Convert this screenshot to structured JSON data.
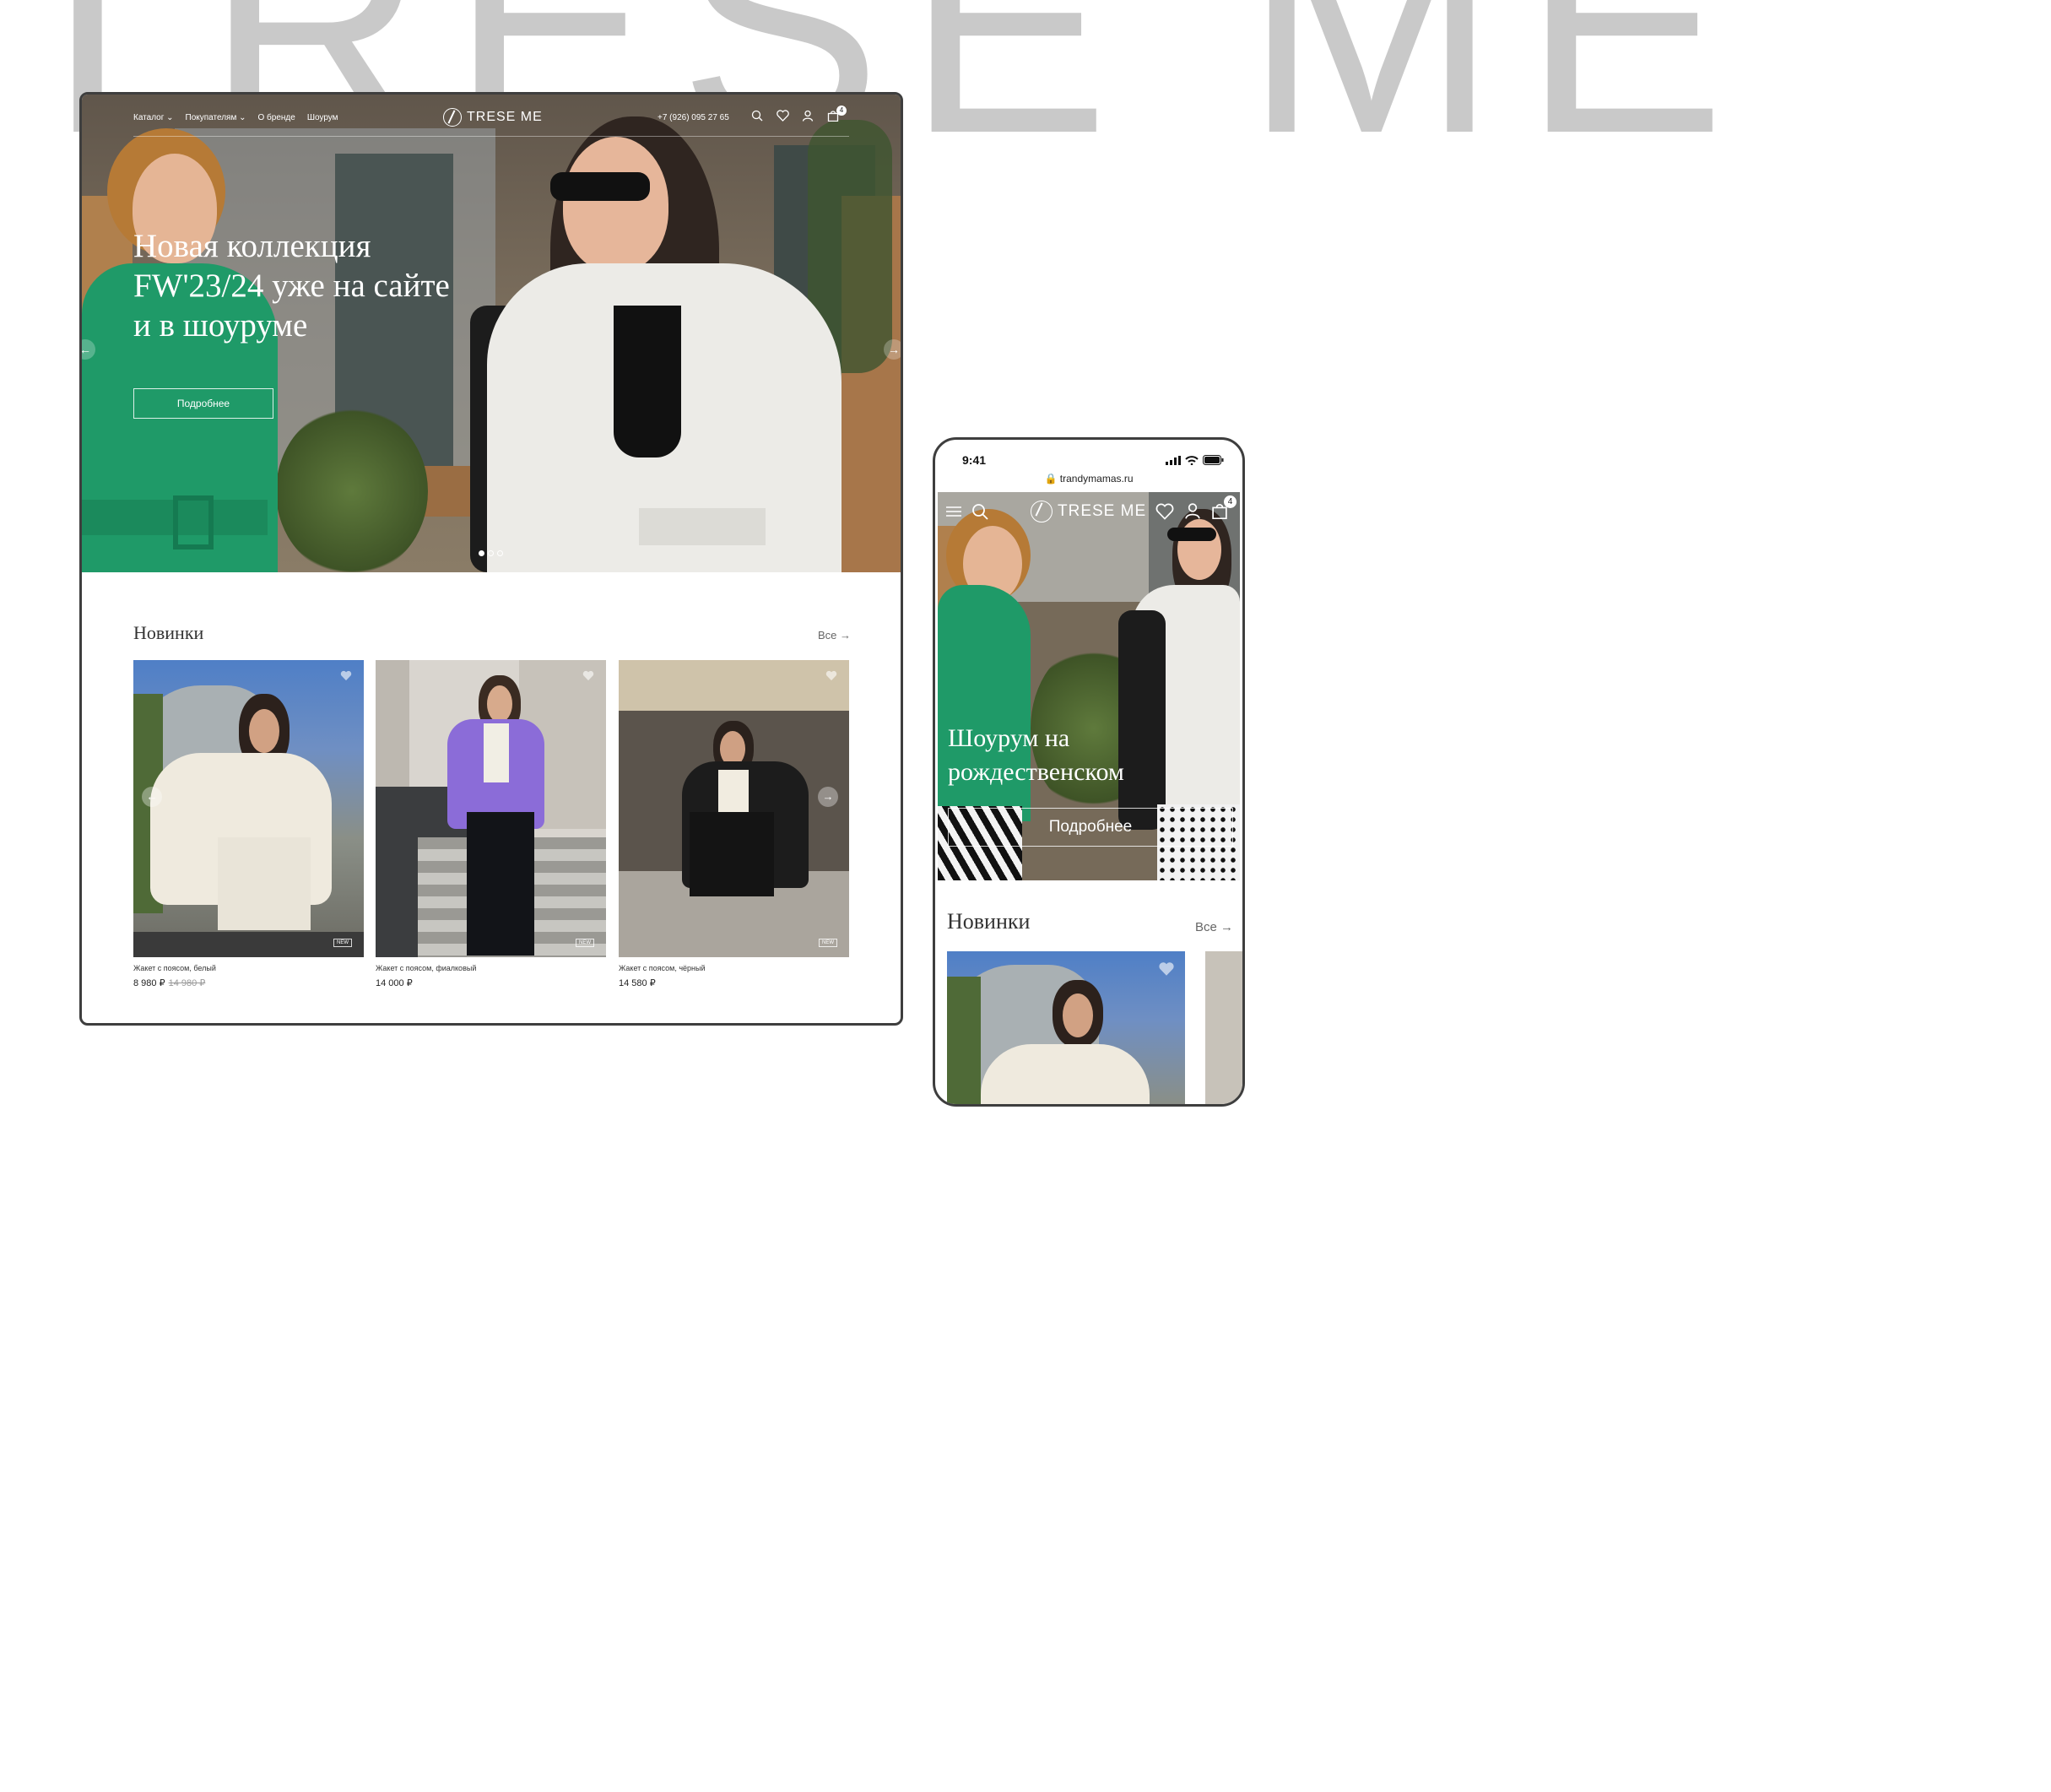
{
  "background": {
    "brand_wordmark": "TRESE ME"
  },
  "desktop": {
    "nav": {
      "items": [
        "Каталог ⌄",
        "Покупателям ⌄",
        "О бренде",
        "Шоурум"
      ]
    },
    "logo": "TRESE ME",
    "phone": "+7 (926) 095 27 65",
    "cart_count": "4",
    "hero": {
      "title": "Новая коллекция FW'23/24 уже на сайте и в шоуруме",
      "cta": "Подробнее",
      "slides": 3,
      "active_slide": 1
    },
    "new_section": {
      "title": "Новинки",
      "all_link": "Все →",
      "products": [
        {
          "name": "Жакет с поясом, белый",
          "price": "8 980 ₽",
          "old_price": "14 980 ₽",
          "tag": "NEW"
        },
        {
          "name": "Жакет с поясом, фиалковый",
          "price": "14 000 ₽",
          "old_price": "",
          "tag": "NEW"
        },
        {
          "name": "Жакет с поясом, чёрный",
          "price": "14 580 ₽",
          "old_price": "",
          "tag": "NEW"
        }
      ]
    }
  },
  "mobile": {
    "status_time": "9:41",
    "url": "trandymamas.ru",
    "logo": "TRESE ME",
    "cart_count": "4",
    "hero": {
      "title": "Шоурум на рождественском",
      "cta": "Подробнее"
    },
    "new_section": {
      "title": "Новинки",
      "all_link": "Все →"
    }
  },
  "colors": {
    "brand_green": "#1f9a68",
    "violet_jacket": "#8b6cd8",
    "frame_border": "#3e3e3e",
    "background_wordmark": "#c9c9c9"
  }
}
